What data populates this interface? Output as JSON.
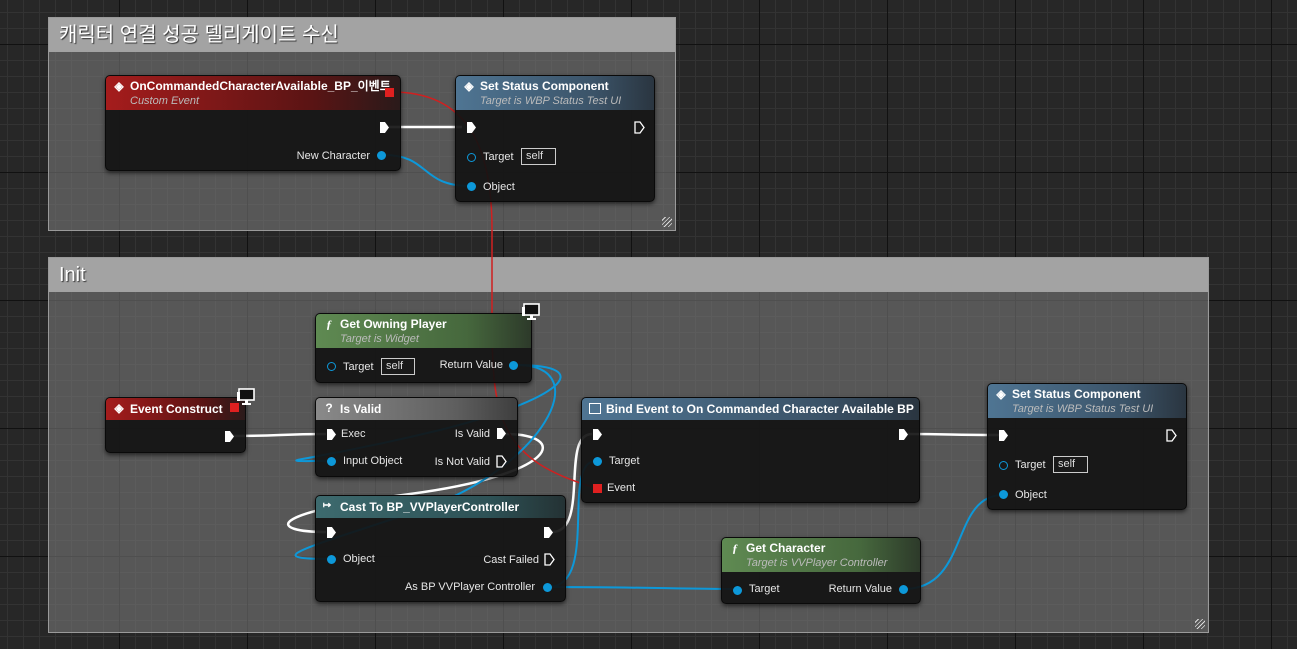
{
  "comments": {
    "top": {
      "title": "캐릭터 연결 성공  델리게이트 수신"
    },
    "init": {
      "title": "Init"
    }
  },
  "nodes": {
    "custom_event": {
      "title": "OnCommandedCharacterAvailable_BP_이벤트",
      "subtitle": "Custom Event",
      "pin_new_character": "New Character"
    },
    "set_status_top": {
      "title": "Set Status Component",
      "subtitle": "Target is WBP Status Test UI",
      "pin_target": "Target",
      "target_default": "self",
      "pin_object": "Object"
    },
    "get_owning_player": {
      "title": "Get Owning Player",
      "subtitle": "Target is Widget",
      "pin_target": "Target",
      "target_default": "self",
      "pin_return": "Return Value"
    },
    "event_construct": {
      "title": "Event Construct"
    },
    "is_valid": {
      "title": "Is Valid",
      "icon": "?",
      "pin_exec": "Exec",
      "pin_input": "Input Object",
      "pin_is_valid": "Is Valid",
      "pin_is_not_valid": "Is Not Valid"
    },
    "bind_event": {
      "title": "Bind Event to On Commanded Character Available BP",
      "pin_target": "Target",
      "pin_event": "Event"
    },
    "set_status_bottom": {
      "title": "Set Status Component",
      "subtitle": "Target is WBP Status Test UI",
      "pin_target": "Target",
      "target_default": "self",
      "pin_object": "Object"
    },
    "cast": {
      "title": "Cast To BP_VVPlayerController",
      "pin_object": "Object",
      "pin_cast_failed": "Cast Failed",
      "pin_as": "As BP VVPlayer Controller"
    },
    "get_character": {
      "title": "Get Character",
      "subtitle": "Target is VVPlayer Controller",
      "pin_target": "Target",
      "pin_return": "Return Value"
    }
  },
  "icons": {
    "event": "event-diamond-icon",
    "function": "function-f-icon",
    "macro": "question-mark-icon",
    "cast": "cast-arrow-icon",
    "bind": "bind-event-icon",
    "client_only": "monitor-icon"
  },
  "colors": {
    "exec_wire": "#ffffff",
    "object_wire": "#0d98d9",
    "delegate_wire": "#e02020",
    "event_header": "#a51c1c",
    "function_header": "#5f8a52",
    "target_header": "#4f7593"
  }
}
